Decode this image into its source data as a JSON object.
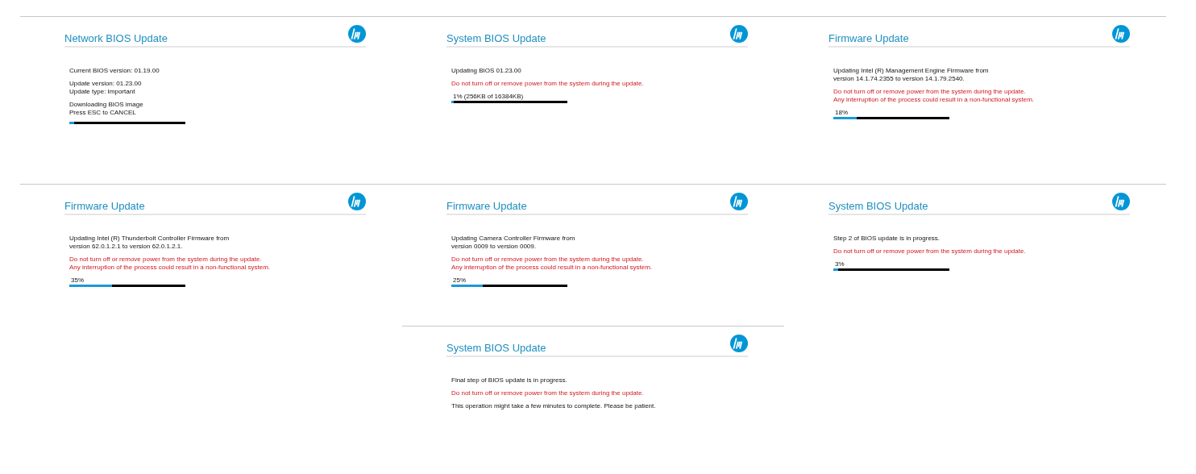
{
  "screens": [
    {
      "title": "Network BIOS Update",
      "blocks": [
        {
          "kind": "text",
          "lines": [
            "Current BIOS version: 01.19.00"
          ]
        },
        {
          "kind": "text",
          "lines": [
            "Update version: 01.23.00",
            "Update type: Important"
          ]
        },
        {
          "kind": "text",
          "lines": [
            "Downloading BIOS image",
            "Press ESC to CANCEL"
          ]
        },
        {
          "kind": "progress",
          "level": 0.04
        }
      ]
    },
    {
      "title": "System BIOS Update",
      "blocks": [
        {
          "kind": "text",
          "lines": [
            "Updating BIOS 01.23.00"
          ]
        },
        {
          "kind": "warning",
          "lines": [
            "Do not turn off or remove power from the system during the update."
          ]
        },
        {
          "kind": "progress",
          "label": "1% (256KB of 16384KB)",
          "level": 0.02
        }
      ]
    },
    {
      "title": "Firmware Update",
      "blocks": [
        {
          "kind": "text",
          "lines": [
            "Updating Intel (R) Management Engine Firmware from",
            "version 14.1.74.2355 to version 14.1.79.2540."
          ]
        },
        {
          "kind": "warning",
          "lines": [
            "Do not turn off or remove power from the system during the update.",
            "Any interruption of the process could result in a non-functional system."
          ]
        },
        {
          "kind": "progress",
          "label": "18%",
          "level": 0.2
        }
      ]
    },
    {
      "title": "Firmware Update",
      "blocks": [
        {
          "kind": "text",
          "lines": [
            "Updating Intel (R) Thunderbolt Controller Firmware from",
            "version 62.0.1.2.1 to version 62.0.1.2.1."
          ]
        },
        {
          "kind": "warning",
          "lines": [
            "Do not turn off or remove power from the system during the update.",
            "Any interruption of the process could result in a non-functional system."
          ]
        },
        {
          "kind": "progress",
          "label": "35%",
          "level": 0.37
        }
      ]
    },
    {
      "title": "Firmware Update",
      "blocks": [
        {
          "kind": "text",
          "lines": [
            "Updating Camera Controller Firmware from",
            "version 0009 to version 0009."
          ]
        },
        {
          "kind": "warning",
          "lines": [
            "Do not turn off or remove power from the system during the update.",
            "Any interruption of the process could result in a non-functional system."
          ]
        },
        {
          "kind": "progress",
          "label": "25%",
          "level": 0.27
        }
      ]
    },
    {
      "title": "System BIOS Update",
      "blocks": [
        {
          "kind": "text",
          "lines": [
            "Step 2 of BIOS update is in progress."
          ]
        },
        {
          "kind": "warning",
          "lines": [
            "Do not turn off or remove power from the system during the update."
          ]
        },
        {
          "kind": "progress",
          "label": "3%",
          "level": 0.04
        }
      ]
    },
    {
      "title": "System BIOS Update",
      "blocks": [
        {
          "kind": "text",
          "lines": [
            "Final step of BIOS update is in progress."
          ]
        },
        {
          "kind": "warning",
          "lines": [
            "Do not turn off or remove power from the system during the update."
          ]
        },
        {
          "kind": "text",
          "lines": [
            "This operation might take a few minutes to complete. Please be patient."
          ]
        }
      ]
    }
  ]
}
